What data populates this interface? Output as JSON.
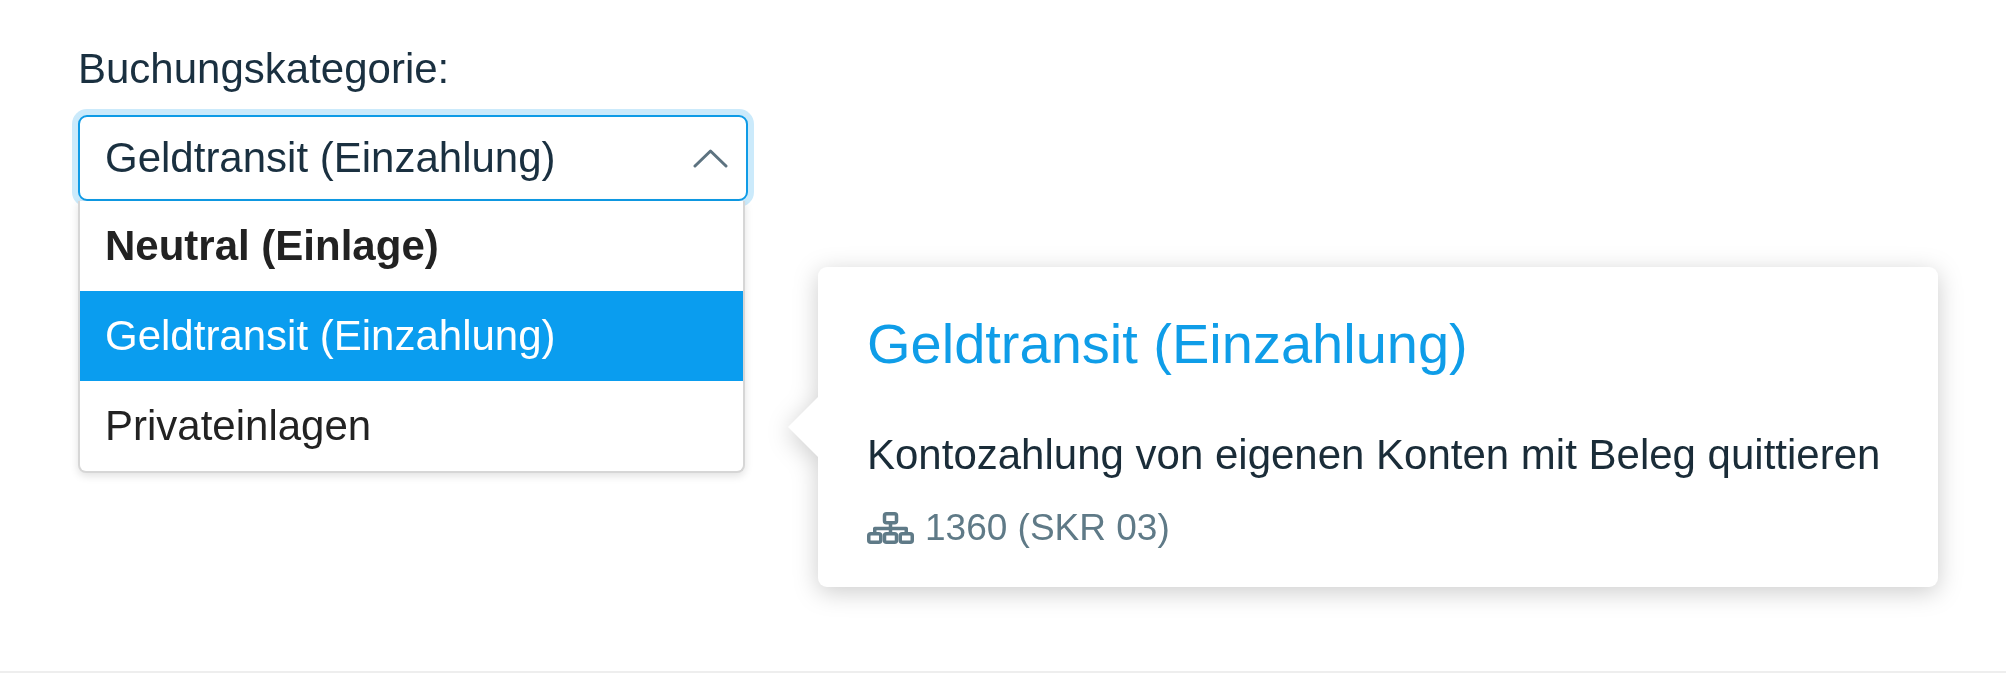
{
  "field": {
    "label": "Buchungskategorie:",
    "value": "Geldtransit (Einzahlung)",
    "focused": true,
    "expanded": true
  },
  "options": [
    {
      "kind": "heading",
      "label": "Neutral (Einlage)",
      "selected": false
    },
    {
      "kind": "option",
      "label": "Geldtransit (Einzahlung)",
      "selected": true
    },
    {
      "kind": "option",
      "label": "Privateinlagen",
      "selected": false
    }
  ],
  "tooltip": {
    "title": "Geldtransit (Einzahlung)",
    "description": "Kontozahlung von eigenen Konten mit Beleg quittieren",
    "account": "1360 (SKR 03)"
  }
}
